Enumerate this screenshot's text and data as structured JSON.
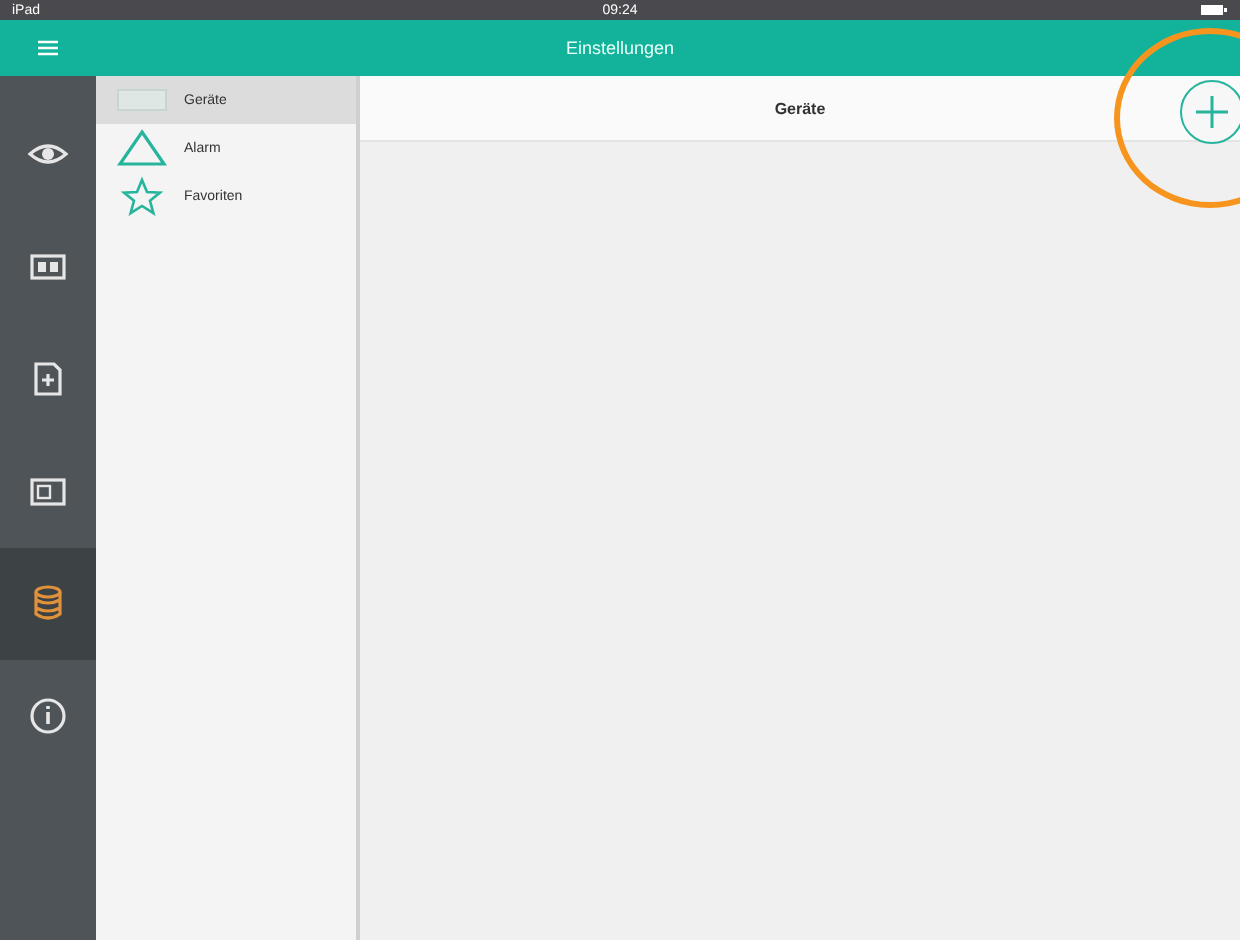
{
  "status_bar": {
    "carrier": "iPad",
    "time": "09:24"
  },
  "nav_bar": {
    "title": "Einstellungen"
  },
  "rail": [
    {
      "kind": "eye",
      "selected": false
    },
    {
      "kind": "card",
      "selected": false
    },
    {
      "kind": "import",
      "selected": false
    },
    {
      "kind": "panel",
      "selected": false
    },
    {
      "kind": "database",
      "selected": true
    },
    {
      "kind": "info",
      "selected": false
    }
  ],
  "list": [
    {
      "kind": "device",
      "label": "Geräte",
      "selected": true
    },
    {
      "kind": "warning",
      "label": "Alarm",
      "selected": false
    },
    {
      "kind": "star",
      "label": "Favoriten",
      "selected": false
    }
  ],
  "detail": {
    "title": "Geräte"
  },
  "annotation": {
    "color": "#f7941d"
  }
}
